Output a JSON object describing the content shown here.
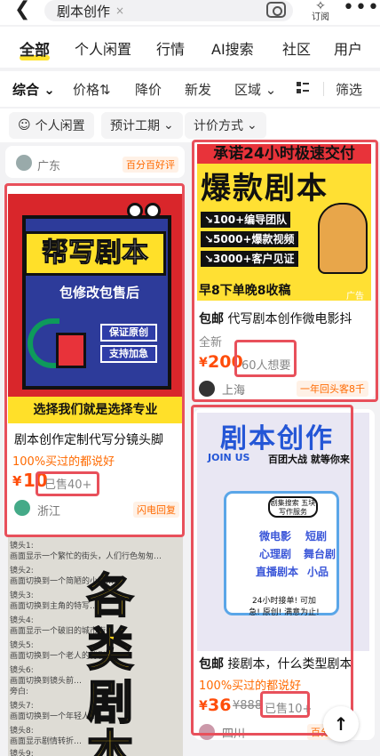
{
  "header": {
    "search_query": "剧本创作",
    "clear_icon": "×",
    "subscribe_label": "订阅",
    "more_icon": "•••"
  },
  "tabs": [
    {
      "label": "全部",
      "active": true
    },
    {
      "label": "个人闲置",
      "active": false
    },
    {
      "label": "行情",
      "active": false
    },
    {
      "label": "AI搜索",
      "active": false
    },
    {
      "label": "社区",
      "active": false
    },
    {
      "label": "用户",
      "active": false
    }
  ],
  "filters": {
    "sort": "综合",
    "price": "价格",
    "price_drop": "降价",
    "new": "新发",
    "region": "区域",
    "filter": "筛选"
  },
  "chips": [
    "个人闲置",
    "预计工期",
    "计价方式"
  ],
  "colors": {
    "accent": "#ffe32e",
    "price": "#ff4d0a",
    "highlight_border": "#e8505b"
  },
  "top_left_card": {
    "location": "广东",
    "badge": "百分百好评"
  },
  "items": [
    {
      "image_title": "帮写剧本",
      "image_subtitle": "包修改包售后",
      "image_badge1": "保证原创",
      "image_badge2": "支持加急",
      "image_footer": "选择我们就是选择专业",
      "title": "剧本创作定制代写分镜头脚",
      "promo": "100%买过的都说好",
      "price_symbol": "¥",
      "price": "10",
      "sold": "已售40+",
      "location": "浙江",
      "tag": "闪电回复"
    },
    {
      "image_header": "承诺24小时极速交付",
      "image_title": "爆款剧本",
      "image_line1": "↘100+编导团队",
      "image_line2": "↘5000+爆款视频",
      "image_line3": "↘3000+客户见证",
      "image_footer": "早8下单晚8收稿",
      "ad_label": "广告",
      "baoyou": "包邮",
      "title": "代写剧本创作微电影抖",
      "condition": "全新",
      "price_symbol": "¥",
      "price": "200",
      "want": "60人想要",
      "location": "上海",
      "tag": "一年回头客8千"
    },
    {
      "image_title": "剧本创作",
      "image_join": "JOIN US",
      "image_tagline": "百团大战 就等你来",
      "image_board_title": "剧集搜索 五块写作服务",
      "keywords": [
        "微电影",
        "短剧",
        "心理剧",
        "舞台剧",
        "直播剧本",
        "小品"
      ],
      "image_note": "24小时接单! 可加急! 原创! 满意为止!",
      "baoyou": "包邮",
      "title": "接剧本，什么类型剧本",
      "promo": "100%买过的都说好",
      "price_symbol": "¥",
      "price": "36",
      "original_price": "¥888",
      "sold": "已售10+",
      "location": "四川",
      "tag": "百分"
    },
    {
      "big_text": [
        "各",
        "类",
        "剧",
        "本"
      ],
      "script_lines": [
        "镜头1:",
        "画面显示一个繁忙的街头，人们行色匆匆…",
        "镜头2:",
        "画面切换到一个简陋的小屋…",
        "镜头3:",
        "画面切换到主角的特写…",
        "镜头4:",
        "画面显示一个破旧的城市街景…",
        "镜头5:",
        "画面切换到一个老人的背影…",
        "镜头6:",
        "画面切换到镜头前…",
        "旁白:",
        "镜头7:",
        "画面切换到一个年轻人…",
        "镜头8:",
        "画面显示剧情转折…",
        "镜头9:",
        "画面切换到结尾…"
      ]
    }
  ]
}
